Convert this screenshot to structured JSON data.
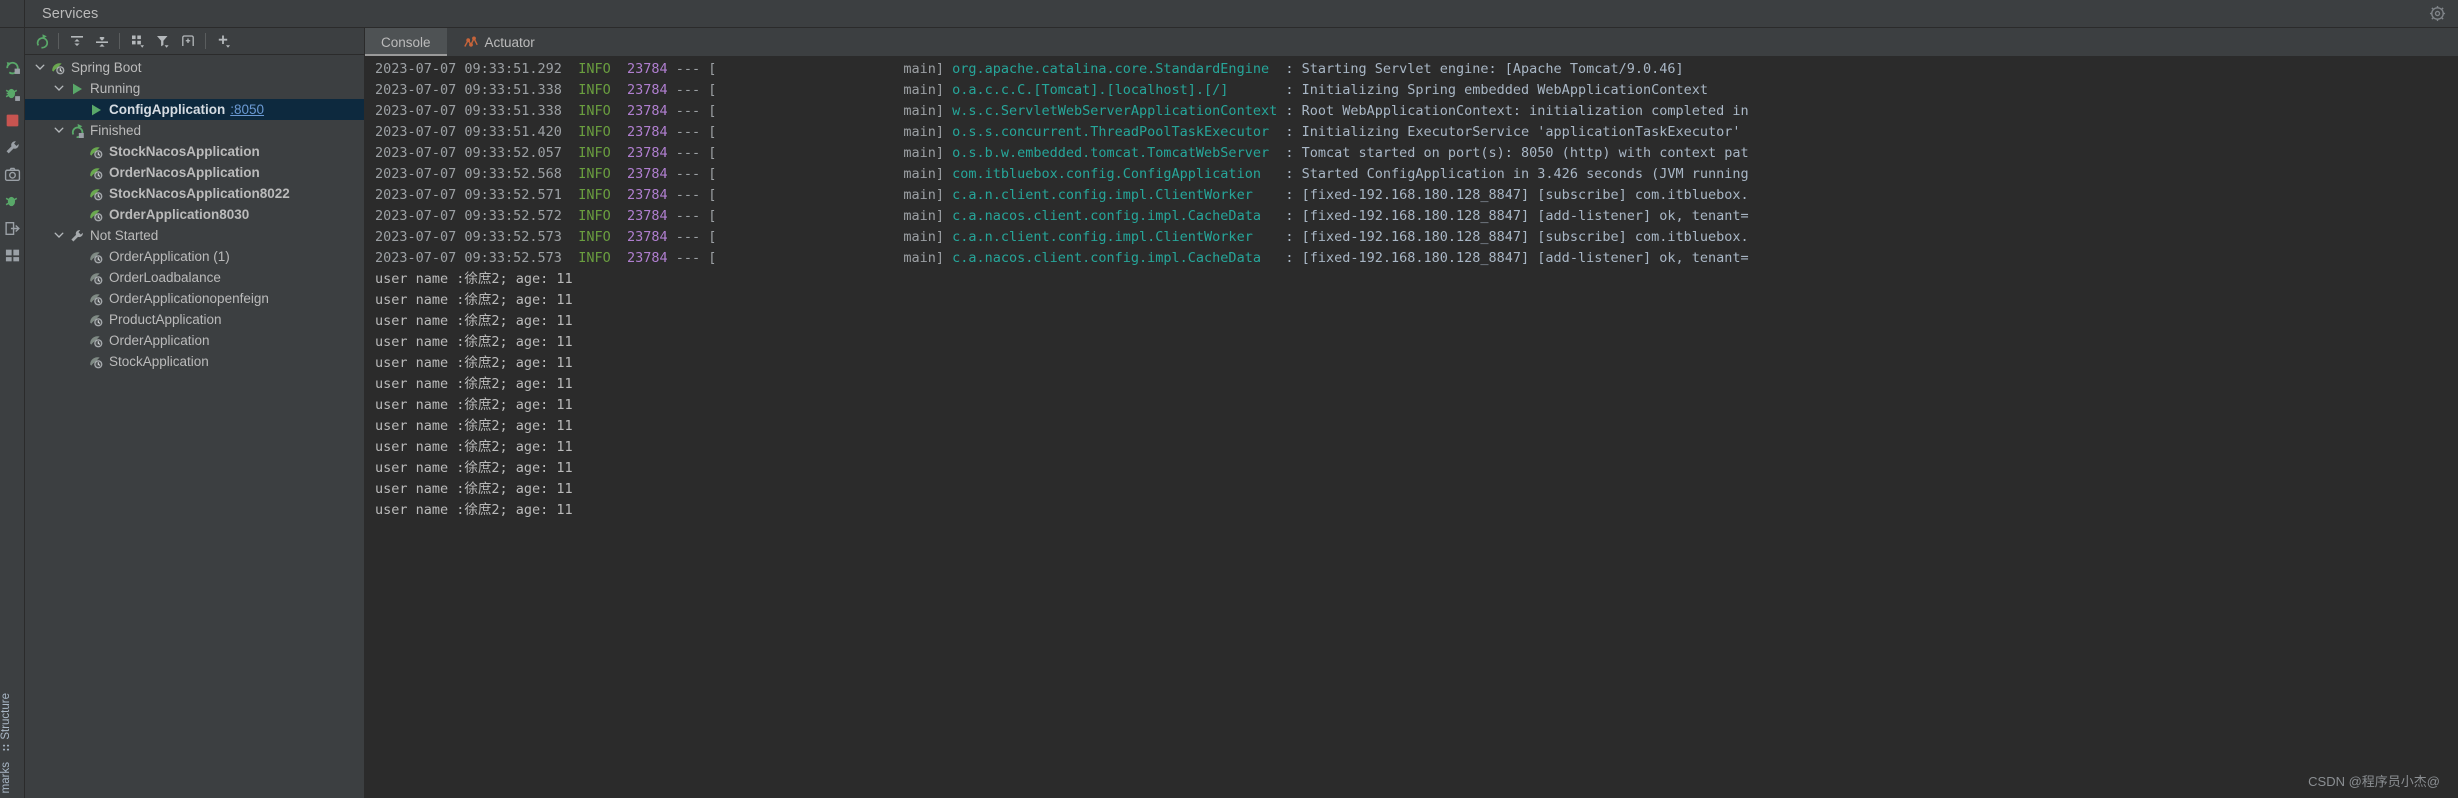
{
  "window": {
    "title": "Services",
    "settings_icon": "gear-icon"
  },
  "left_strip": {
    "icons": [
      {
        "name": "run-rerun-icon"
      },
      {
        "name": "debug-icon"
      },
      {
        "name": "stop-icon"
      },
      {
        "name": "build-wrench-icon"
      },
      {
        "name": "camera-icon"
      },
      {
        "name": "coverage-icon"
      },
      {
        "name": "export-icon"
      },
      {
        "name": "layout-icon"
      }
    ],
    "labels": [
      "Structure",
      "marks"
    ]
  },
  "tree_toolbar": {
    "buttons": [
      {
        "name": "rerun-icon",
        "label": "Rerun"
      },
      {
        "name": "expand-all-icon",
        "label": "Expand All"
      },
      {
        "name": "collapse-all-icon",
        "label": "Collapse All"
      },
      {
        "name": "group-by-icon",
        "label": "Group By"
      },
      {
        "name": "filter-icon",
        "label": "Filter"
      },
      {
        "name": "show-in-new-tab-icon",
        "label": "Open in New Tab"
      },
      {
        "name": "add-icon",
        "label": "Add Service"
      }
    ]
  },
  "tree": {
    "nodes": [
      {
        "label": "Spring Boot",
        "indent": 0,
        "expanded": true,
        "icon": "spring-boot-icon",
        "bold": false,
        "selected": false
      },
      {
        "label": "Running",
        "indent": 1,
        "expanded": true,
        "icon": "run-green-triangle-icon",
        "bold": false,
        "selected": false
      },
      {
        "label": "ConfigApplication",
        "port": ":8050",
        "indent": 2,
        "expanded": null,
        "icon": "run-green-triangle-icon",
        "bold": true,
        "selected": true
      },
      {
        "label": "Finished",
        "indent": 1,
        "expanded": true,
        "icon": "rerun-green-arrow-icon",
        "bold": false,
        "selected": false
      },
      {
        "label": "StockNacosApplication",
        "indent": 2,
        "expanded": null,
        "icon": "spring-boot-icon",
        "bold": true,
        "selected": false
      },
      {
        "label": "OrderNacosApplication",
        "indent": 2,
        "expanded": null,
        "icon": "spring-boot-icon",
        "bold": true,
        "selected": false
      },
      {
        "label": "StockNacosApplication8022",
        "indent": 2,
        "expanded": null,
        "icon": "spring-boot-icon",
        "bold": true,
        "selected": false
      },
      {
        "label": "OrderApplication8030",
        "indent": 2,
        "expanded": null,
        "icon": "spring-boot-icon",
        "bold": true,
        "selected": false
      },
      {
        "label": "Not Started",
        "indent": 1,
        "expanded": true,
        "icon": "wrench-icon",
        "bold": false,
        "selected": false
      },
      {
        "label": "OrderApplication (1)",
        "indent": 2,
        "expanded": null,
        "icon": "spring-boot-grey-icon",
        "bold": false,
        "selected": false
      },
      {
        "label": "OrderLoadbalance",
        "indent": 2,
        "expanded": null,
        "icon": "spring-boot-grey-icon",
        "bold": false,
        "selected": false
      },
      {
        "label": "OrderApplicationopenfeign",
        "indent": 2,
        "expanded": null,
        "icon": "spring-boot-grey-icon",
        "bold": false,
        "selected": false
      },
      {
        "label": "ProductApplication",
        "indent": 2,
        "expanded": null,
        "icon": "spring-boot-grey-icon",
        "bold": false,
        "selected": false
      },
      {
        "label": "OrderApplication",
        "indent": 2,
        "expanded": null,
        "icon": "spring-boot-grey-icon",
        "bold": false,
        "selected": false
      },
      {
        "label": "StockApplication",
        "indent": 2,
        "expanded": null,
        "icon": "spring-boot-grey-icon",
        "bold": false,
        "selected": false
      }
    ]
  },
  "console": {
    "tabs": [
      {
        "label": "Console",
        "icon": null,
        "active": true
      },
      {
        "label": "Actuator",
        "icon": "actuator-chart-icon",
        "active": false
      }
    ],
    "log_lines": [
      {
        "kind": "spring",
        "ts": "2023-07-07 09:33:51.292",
        "level": "INFO",
        "pid": "23784",
        "thread": "main",
        "logger": "org.apache.catalina.core.StandardEngine",
        "message": "Starting Servlet engine: [Apache Tomcat/9.0.46]"
      },
      {
        "kind": "spring",
        "ts": "2023-07-07 09:33:51.338",
        "level": "INFO",
        "pid": "23784",
        "thread": "main",
        "logger": "o.a.c.c.C.[Tomcat].[localhost].[/]",
        "message": "Initializing Spring embedded WebApplicationContext"
      },
      {
        "kind": "spring",
        "ts": "2023-07-07 09:33:51.338",
        "level": "INFO",
        "pid": "23784",
        "thread": "main",
        "logger": "w.s.c.ServletWebServerApplicationContext",
        "message": "Root WebApplicationContext: initialization completed in"
      },
      {
        "kind": "spring",
        "ts": "2023-07-07 09:33:51.420",
        "level": "INFO",
        "pid": "23784",
        "thread": "main",
        "logger": "o.s.s.concurrent.ThreadPoolTaskExecutor",
        "message": "Initializing ExecutorService 'applicationTaskExecutor'"
      },
      {
        "kind": "spring",
        "ts": "2023-07-07 09:33:52.057",
        "level": "INFO",
        "pid": "23784",
        "thread": "main",
        "logger": "o.s.b.w.embedded.tomcat.TomcatWebServer",
        "message": "Tomcat started on port(s): 8050 (http) with context pat"
      },
      {
        "kind": "spring",
        "ts": "2023-07-07 09:33:52.568",
        "level": "INFO",
        "pid": "23784",
        "thread": "main",
        "logger": "com.itbluebox.config.ConfigApplication",
        "message": "Started ConfigApplication in 3.426 seconds (JVM running"
      },
      {
        "kind": "spring",
        "ts": "2023-07-07 09:33:52.571",
        "level": "INFO",
        "pid": "23784",
        "thread": "main",
        "logger": "c.a.n.client.config.impl.ClientWorker",
        "message": "[fixed-192.168.180.128_8847] [subscribe] com.itbluebox."
      },
      {
        "kind": "spring",
        "ts": "2023-07-07 09:33:52.572",
        "level": "INFO",
        "pid": "23784",
        "thread": "main",
        "logger": "c.a.nacos.client.config.impl.CacheData",
        "message": "[fixed-192.168.180.128_8847] [add-listener] ok, tenant="
      },
      {
        "kind": "spring",
        "ts": "2023-07-07 09:33:52.573",
        "level": "INFO",
        "pid": "23784",
        "thread": "main",
        "logger": "c.a.n.client.config.impl.ClientWorker",
        "message": "[fixed-192.168.180.128_8847] [subscribe] com.itbluebox."
      },
      {
        "kind": "spring",
        "ts": "2023-07-07 09:33:52.573",
        "level": "INFO",
        "pid": "23784",
        "thread": "main",
        "logger": "c.a.nacos.client.config.impl.CacheData",
        "message": "[fixed-192.168.180.128_8847] [add-listener] ok, tenant="
      },
      {
        "kind": "plain",
        "text": "user name :徐庶2; age: 11"
      },
      {
        "kind": "plain",
        "text": "user name :徐庶2; age: 11"
      },
      {
        "kind": "plain",
        "text": "user name :徐庶2; age: 11"
      },
      {
        "kind": "plain",
        "text": "user name :徐庶2; age: 11"
      },
      {
        "kind": "plain",
        "text": "user name :徐庶2; age: 11"
      },
      {
        "kind": "plain",
        "text": "user name :徐庶2; age: 11"
      },
      {
        "kind": "plain",
        "text": "user name :徐庶2; age: 11"
      },
      {
        "kind": "plain",
        "text": "user name :徐庶2; age: 11"
      },
      {
        "kind": "plain",
        "text": "user name :徐庶2; age: 11"
      },
      {
        "kind": "plain",
        "text": "user name :徐庶2; age: 11"
      },
      {
        "kind": "plain",
        "text": "user name :徐庶2; age: 11"
      },
      {
        "kind": "plain",
        "text": "user name :徐庶2; age: 11"
      }
    ],
    "watermark": "CSDN @程序员小杰@"
  },
  "colors": {
    "panel_bg": "#3c3f41",
    "console_bg": "#2b2b2b",
    "selection_bg": "#0d293e",
    "accent_green": "#5a9c3c",
    "link_blue": "#6b9ad4",
    "logger_teal": "#26a69a",
    "pid_purple": "#b07fd0"
  }
}
